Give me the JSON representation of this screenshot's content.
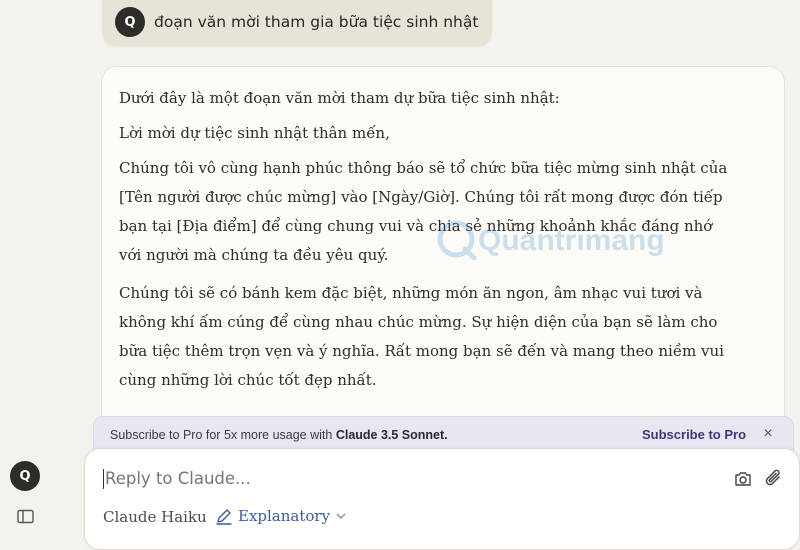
{
  "user_message": {
    "avatar_initial": "Q",
    "text": "đoạn văn mời tham gia bữa tiệc sinh nhật"
  },
  "assistant_message": {
    "paragraphs": [
      "Dưới đây là một đoạn văn mời tham dự bữa tiệc sinh nhật:",
      "Lời mời dự tiệc sinh nhật thân mến,",
      "Chúng tôi vô cùng hạnh phúc thông báo sẽ tổ chức bữa tiệc mừng sinh nhật của [Tên người được chúc mừng] vào [Ngày/Giờ]. Chúng tôi rất mong được đón tiếp bạn tại [Địa điểm] để cùng chung vui và chia sẻ những khoảnh khắc đáng nhớ với người mà chúng ta đều yêu quý.",
      "Chúng tôi sẽ có bánh kem đặc biệt, những món ăn ngon, âm nhạc vui tươi và không khí ấm cúng để cùng nhau chúc mừng. Sự hiện diện của bạn sẽ làm cho bữa tiệc thêm trọn vẹn và ý nghĩa. Rất mong bạn sẽ đến và mang theo niềm vui cùng những lời chúc tốt đẹp nhất."
    ]
  },
  "watermark": "Quantrimang",
  "pro_banner": {
    "message_prefix": "Subscribe to Pro for 5x more usage with ",
    "message_model": "Claude 3.5 Sonnet.",
    "link": "Subscribe to Pro",
    "close_glyph": "×"
  },
  "composer": {
    "placeholder": "Reply to Claude...",
    "model": "Claude Haiku",
    "style": "Explanatory"
  },
  "sidebar": {
    "avatar_initial": "Q"
  },
  "colors": {
    "background": "#f4f2ec",
    "accent_link": "#3c3b7a",
    "style_blue": "#3d5a9a"
  }
}
